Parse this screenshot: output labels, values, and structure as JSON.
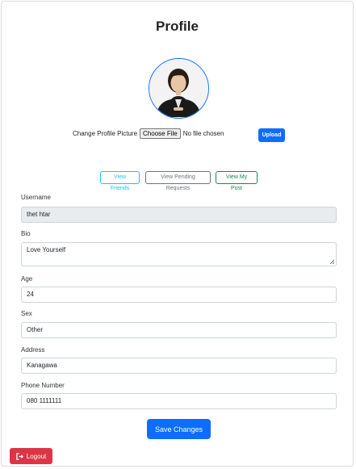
{
  "page": {
    "title": "Profile"
  },
  "avatar": {
    "icon": "profile-photo"
  },
  "upload": {
    "label": "Change Profile Picture",
    "choose_label": "Choose File",
    "file_status": "No file chosen",
    "upload_label": "Upload"
  },
  "links": {
    "friends": "View Friends",
    "pending": "View Pending Requests",
    "posts": "View My Post"
  },
  "form": {
    "username": {
      "label": "Username",
      "value": "thet htar",
      "disabled": true
    },
    "bio": {
      "label": "Bio",
      "value": "Love Yourself"
    },
    "age": {
      "label": "Age",
      "value": "24"
    },
    "sex": {
      "label": "Sex",
      "value": "Other"
    },
    "address": {
      "label": "Address",
      "value": "Kanagawa"
    },
    "phone": {
      "label": "Phone Number",
      "value": "080 1111111"
    }
  },
  "actions": {
    "save_label": "Save Changes",
    "logout_label": "Logout",
    "logout_icon": "logout-icon"
  },
  "colors": {
    "primary": "#0d6efd",
    "info": "#0dcaf0",
    "secondary": "#6c757d",
    "success": "#198754",
    "danger": "#dc3545"
  }
}
